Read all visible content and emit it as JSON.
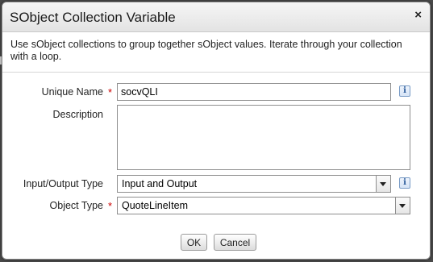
{
  "dialog": {
    "title": "SObject Collection Variable",
    "description": "Use sObject collections to group together sObject values. Iterate through your collection with a loop."
  },
  "form": {
    "unique_name_label": "Unique Name",
    "unique_name_value": "socvQLI",
    "description_label": "Description",
    "description_value": "",
    "io_type_label": "Input/Output Type",
    "io_type_value": "Input and Output",
    "object_type_label": "Object Type",
    "object_type_value": "QuoteLineItem",
    "required_marker": "*",
    "info_glyph": "i"
  },
  "buttons": {
    "ok": "OK",
    "cancel": "Cancel"
  },
  "icons": {
    "close": "×"
  },
  "colors": {
    "required": "#cc0000",
    "info": "#2a5a9a"
  }
}
